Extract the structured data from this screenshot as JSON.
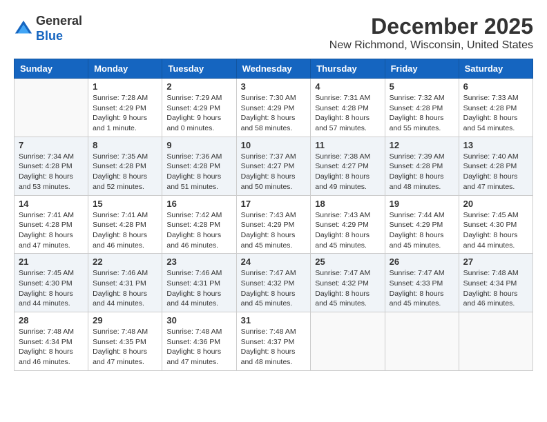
{
  "logo": {
    "general": "General",
    "blue": "Blue"
  },
  "title": "December 2025",
  "location": "New Richmond, Wisconsin, United States",
  "days_of_week": [
    "Sunday",
    "Monday",
    "Tuesday",
    "Wednesday",
    "Thursday",
    "Friday",
    "Saturday"
  ],
  "weeks": [
    [
      {
        "day": "",
        "sunrise": "",
        "sunset": "",
        "daylight": ""
      },
      {
        "day": "1",
        "sunrise": "Sunrise: 7:28 AM",
        "sunset": "Sunset: 4:29 PM",
        "daylight": "Daylight: 9 hours and 1 minute."
      },
      {
        "day": "2",
        "sunrise": "Sunrise: 7:29 AM",
        "sunset": "Sunset: 4:29 PM",
        "daylight": "Daylight: 9 hours and 0 minutes."
      },
      {
        "day": "3",
        "sunrise": "Sunrise: 7:30 AM",
        "sunset": "Sunset: 4:29 PM",
        "daylight": "Daylight: 8 hours and 58 minutes."
      },
      {
        "day": "4",
        "sunrise": "Sunrise: 7:31 AM",
        "sunset": "Sunset: 4:28 PM",
        "daylight": "Daylight: 8 hours and 57 minutes."
      },
      {
        "day": "5",
        "sunrise": "Sunrise: 7:32 AM",
        "sunset": "Sunset: 4:28 PM",
        "daylight": "Daylight: 8 hours and 55 minutes."
      },
      {
        "day": "6",
        "sunrise": "Sunrise: 7:33 AM",
        "sunset": "Sunset: 4:28 PM",
        "daylight": "Daylight: 8 hours and 54 minutes."
      }
    ],
    [
      {
        "day": "7",
        "sunrise": "Sunrise: 7:34 AM",
        "sunset": "Sunset: 4:28 PM",
        "daylight": "Daylight: 8 hours and 53 minutes."
      },
      {
        "day": "8",
        "sunrise": "Sunrise: 7:35 AM",
        "sunset": "Sunset: 4:28 PM",
        "daylight": "Daylight: 8 hours and 52 minutes."
      },
      {
        "day": "9",
        "sunrise": "Sunrise: 7:36 AM",
        "sunset": "Sunset: 4:28 PM",
        "daylight": "Daylight: 8 hours and 51 minutes."
      },
      {
        "day": "10",
        "sunrise": "Sunrise: 7:37 AM",
        "sunset": "Sunset: 4:27 PM",
        "daylight": "Daylight: 8 hours and 50 minutes."
      },
      {
        "day": "11",
        "sunrise": "Sunrise: 7:38 AM",
        "sunset": "Sunset: 4:27 PM",
        "daylight": "Daylight: 8 hours and 49 minutes."
      },
      {
        "day": "12",
        "sunrise": "Sunrise: 7:39 AM",
        "sunset": "Sunset: 4:28 PM",
        "daylight": "Daylight: 8 hours and 48 minutes."
      },
      {
        "day": "13",
        "sunrise": "Sunrise: 7:40 AM",
        "sunset": "Sunset: 4:28 PM",
        "daylight": "Daylight: 8 hours and 47 minutes."
      }
    ],
    [
      {
        "day": "14",
        "sunrise": "Sunrise: 7:41 AM",
        "sunset": "Sunset: 4:28 PM",
        "daylight": "Daylight: 8 hours and 47 minutes."
      },
      {
        "day": "15",
        "sunrise": "Sunrise: 7:41 AM",
        "sunset": "Sunset: 4:28 PM",
        "daylight": "Daylight: 8 hours and 46 minutes."
      },
      {
        "day": "16",
        "sunrise": "Sunrise: 7:42 AM",
        "sunset": "Sunset: 4:28 PM",
        "daylight": "Daylight: 8 hours and 46 minutes."
      },
      {
        "day": "17",
        "sunrise": "Sunrise: 7:43 AM",
        "sunset": "Sunset: 4:29 PM",
        "daylight": "Daylight: 8 hours and 45 minutes."
      },
      {
        "day": "18",
        "sunrise": "Sunrise: 7:43 AM",
        "sunset": "Sunset: 4:29 PM",
        "daylight": "Daylight: 8 hours and 45 minutes."
      },
      {
        "day": "19",
        "sunrise": "Sunrise: 7:44 AM",
        "sunset": "Sunset: 4:29 PM",
        "daylight": "Daylight: 8 hours and 45 minutes."
      },
      {
        "day": "20",
        "sunrise": "Sunrise: 7:45 AM",
        "sunset": "Sunset: 4:30 PM",
        "daylight": "Daylight: 8 hours and 44 minutes."
      }
    ],
    [
      {
        "day": "21",
        "sunrise": "Sunrise: 7:45 AM",
        "sunset": "Sunset: 4:30 PM",
        "daylight": "Daylight: 8 hours and 44 minutes."
      },
      {
        "day": "22",
        "sunrise": "Sunrise: 7:46 AM",
        "sunset": "Sunset: 4:31 PM",
        "daylight": "Daylight: 8 hours and 44 minutes."
      },
      {
        "day": "23",
        "sunrise": "Sunrise: 7:46 AM",
        "sunset": "Sunset: 4:31 PM",
        "daylight": "Daylight: 8 hours and 44 minutes."
      },
      {
        "day": "24",
        "sunrise": "Sunrise: 7:47 AM",
        "sunset": "Sunset: 4:32 PM",
        "daylight": "Daylight: 8 hours and 45 minutes."
      },
      {
        "day": "25",
        "sunrise": "Sunrise: 7:47 AM",
        "sunset": "Sunset: 4:32 PM",
        "daylight": "Daylight: 8 hours and 45 minutes."
      },
      {
        "day": "26",
        "sunrise": "Sunrise: 7:47 AM",
        "sunset": "Sunset: 4:33 PM",
        "daylight": "Daylight: 8 hours and 45 minutes."
      },
      {
        "day": "27",
        "sunrise": "Sunrise: 7:48 AM",
        "sunset": "Sunset: 4:34 PM",
        "daylight": "Daylight: 8 hours and 46 minutes."
      }
    ],
    [
      {
        "day": "28",
        "sunrise": "Sunrise: 7:48 AM",
        "sunset": "Sunset: 4:34 PM",
        "daylight": "Daylight: 8 hours and 46 minutes."
      },
      {
        "day": "29",
        "sunrise": "Sunrise: 7:48 AM",
        "sunset": "Sunset: 4:35 PM",
        "daylight": "Daylight: 8 hours and 47 minutes."
      },
      {
        "day": "30",
        "sunrise": "Sunrise: 7:48 AM",
        "sunset": "Sunset: 4:36 PM",
        "daylight": "Daylight: 8 hours and 47 minutes."
      },
      {
        "day": "31",
        "sunrise": "Sunrise: 7:48 AM",
        "sunset": "Sunset: 4:37 PM",
        "daylight": "Daylight: 8 hours and 48 minutes."
      },
      {
        "day": "",
        "sunrise": "",
        "sunset": "",
        "daylight": ""
      },
      {
        "day": "",
        "sunrise": "",
        "sunset": "",
        "daylight": ""
      },
      {
        "day": "",
        "sunrise": "",
        "sunset": "",
        "daylight": ""
      }
    ]
  ]
}
